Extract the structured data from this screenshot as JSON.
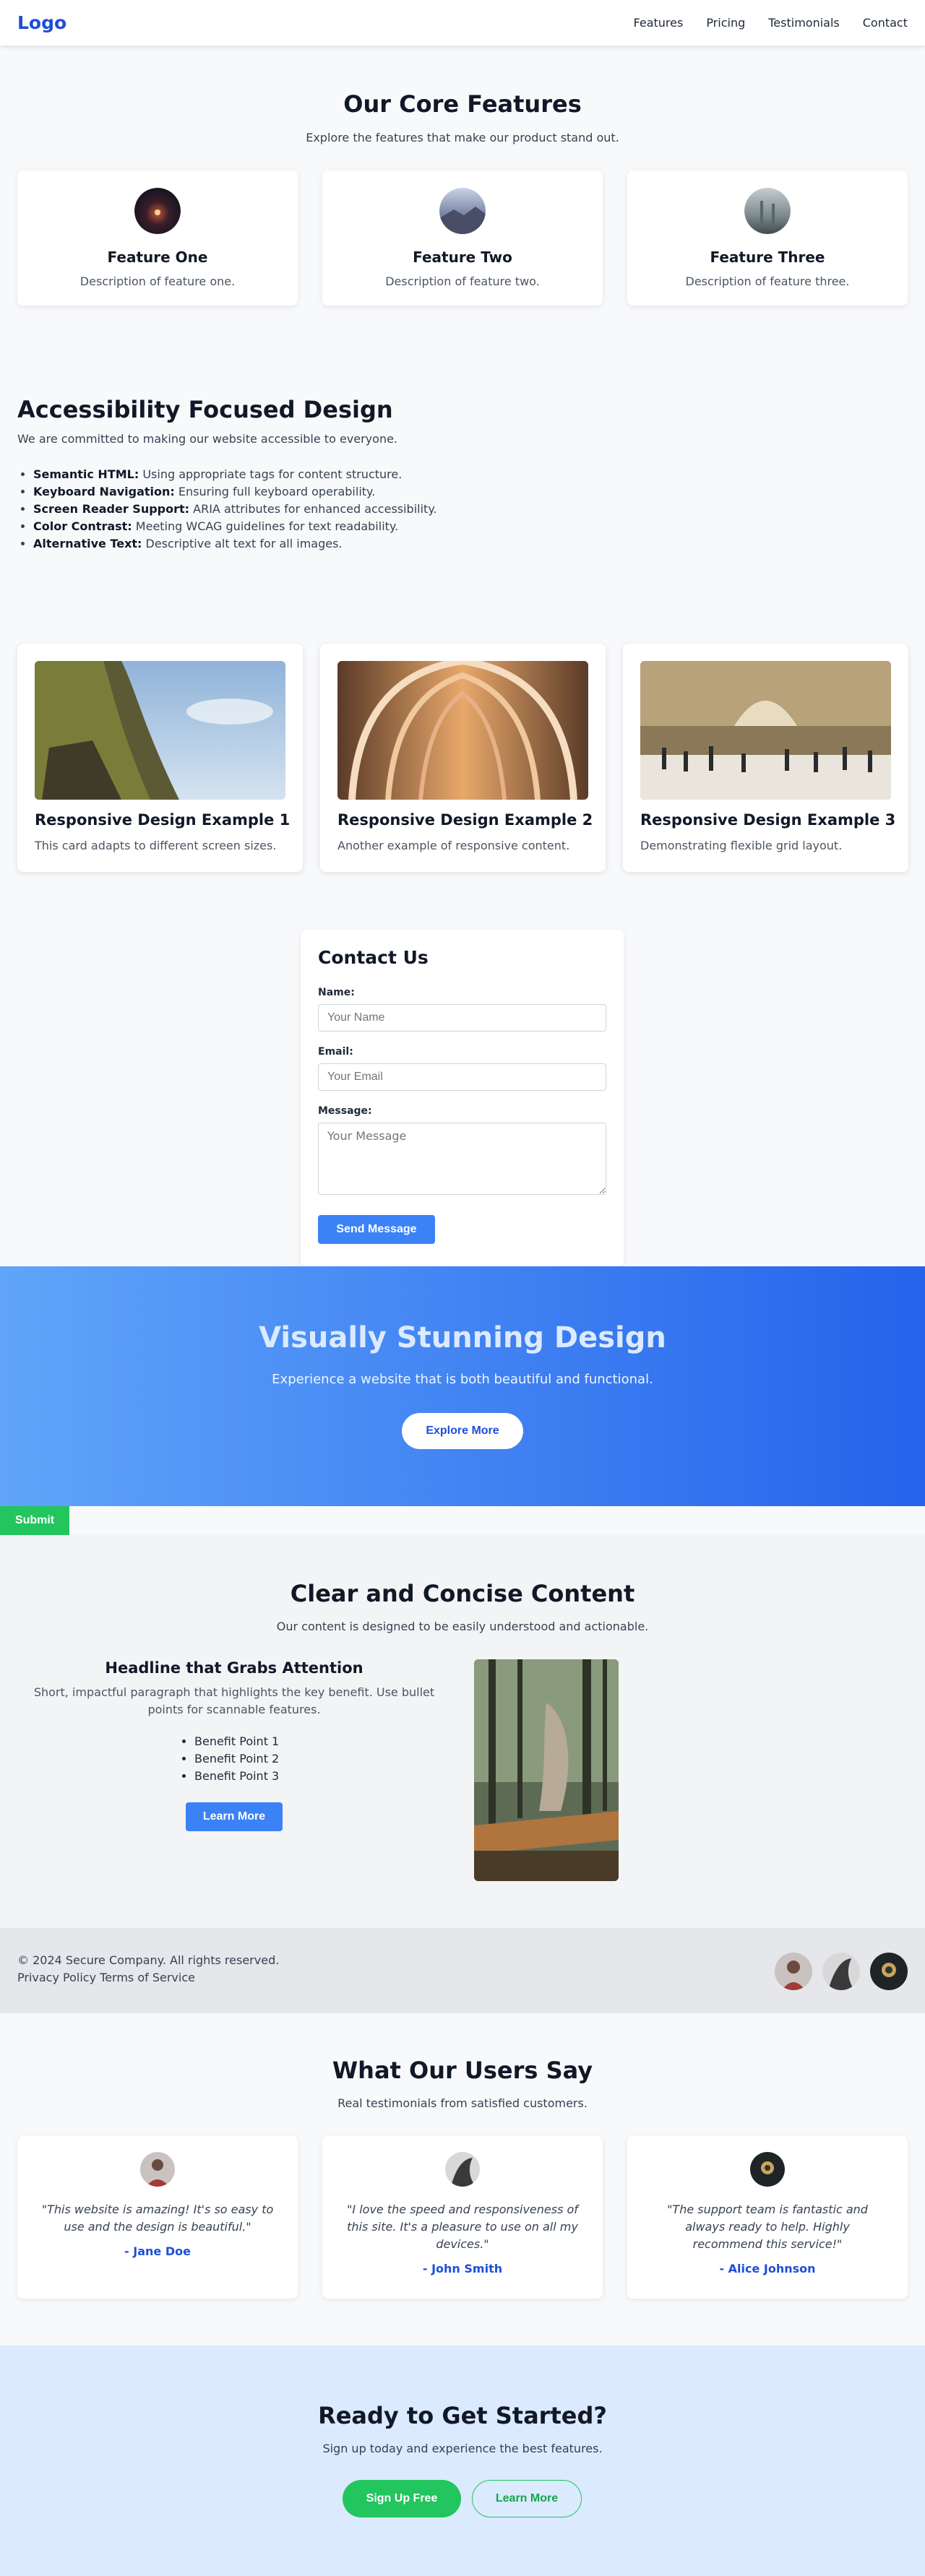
{
  "nav": {
    "logo": "Logo",
    "links": [
      "Features",
      "Pricing",
      "Testimonials",
      "Contact"
    ]
  },
  "features": {
    "title": "Our Core Features",
    "subtitle": "Explore the features that make our product stand out.",
    "cards": [
      {
        "title": "Feature One",
        "desc": "Description of feature one."
      },
      {
        "title": "Feature Two",
        "desc": "Description of feature two."
      },
      {
        "title": "Feature Three",
        "desc": "Description of feature three."
      }
    ]
  },
  "accessibility": {
    "title": "Accessibility Focused Design",
    "intro": "We are committed to making our website accessible to everyone.",
    "items": [
      {
        "term": "Semantic HTML:",
        "text": " Using appropriate tags for content structure."
      },
      {
        "term": "Keyboard Navigation:",
        "text": " Ensuring full keyboard operability."
      },
      {
        "term": "Screen Reader Support:",
        "text": " ARIA attributes for enhanced accessibility."
      },
      {
        "term": "Color Contrast:",
        "text": " Meeting WCAG guidelines for text readability."
      },
      {
        "term": "Alternative Text:",
        "text": " Descriptive alt text for all images."
      }
    ]
  },
  "responsive": {
    "cards": [
      {
        "title": "Responsive Design Example 1",
        "desc": "This card adapts to different screen sizes."
      },
      {
        "title": "Responsive Design Example 2",
        "desc": "Another example of responsive content."
      },
      {
        "title": "Responsive Design Example 3",
        "desc": "Demonstrating flexible grid layout."
      }
    ]
  },
  "contact": {
    "title": "Contact Us",
    "name_label": "Name:",
    "name_placeholder": "Your Name",
    "email_label": "Email:",
    "email_placeholder": "Your Email",
    "message_label": "Message:",
    "message_placeholder": "Your Message",
    "send_label": "Send Message"
  },
  "hero": {
    "title": "Visually Stunning Design",
    "subtitle": "Experience a website that is both beautiful and functional.",
    "button": "Explore More",
    "submit": "Submit"
  },
  "clear": {
    "title": "Clear and Concise Content",
    "subtitle": "Our content is designed to be easily understood and actionable.",
    "headline": "Headline that Grabs Attention",
    "paragraph": "Short, impactful paragraph that highlights the key benefit. Use bullet points for scannable features.",
    "benefits": [
      "Benefit Point 1",
      "Benefit Point 2",
      "Benefit Point 3"
    ],
    "button": "Learn More"
  },
  "footer": {
    "copyright": "© 2024 Secure Company. All rights reserved.",
    "privacy": "Privacy Policy",
    "terms": "Terms of Service"
  },
  "testimonials": {
    "title": "What Our Users Say",
    "subtitle": "Real testimonials from satisfied customers.",
    "items": [
      {
        "quote": "\"This website is amazing! It's so easy to use and the design is beautiful.\"",
        "author": "- Jane Doe"
      },
      {
        "quote": "\"I love the speed and responsiveness of this site. It's a pleasure to use on all my devices.\"",
        "author": "- John Smith"
      },
      {
        "quote": "\"The support team is fantastic and always ready to help. Highly recommend this service!\"",
        "author": "- Alice Johnson"
      }
    ]
  },
  "cta": {
    "title": "Ready to Get Started?",
    "subtitle": "Sign up today and experience the best features.",
    "primary": "Sign Up Free",
    "secondary": "Learn More"
  },
  "colors": {
    "brand": "#1d4ed8",
    "button_blue": "#3b82f6",
    "green": "#22c55e",
    "hero_start": "#60a5fa",
    "hero_end": "#2563eb"
  }
}
